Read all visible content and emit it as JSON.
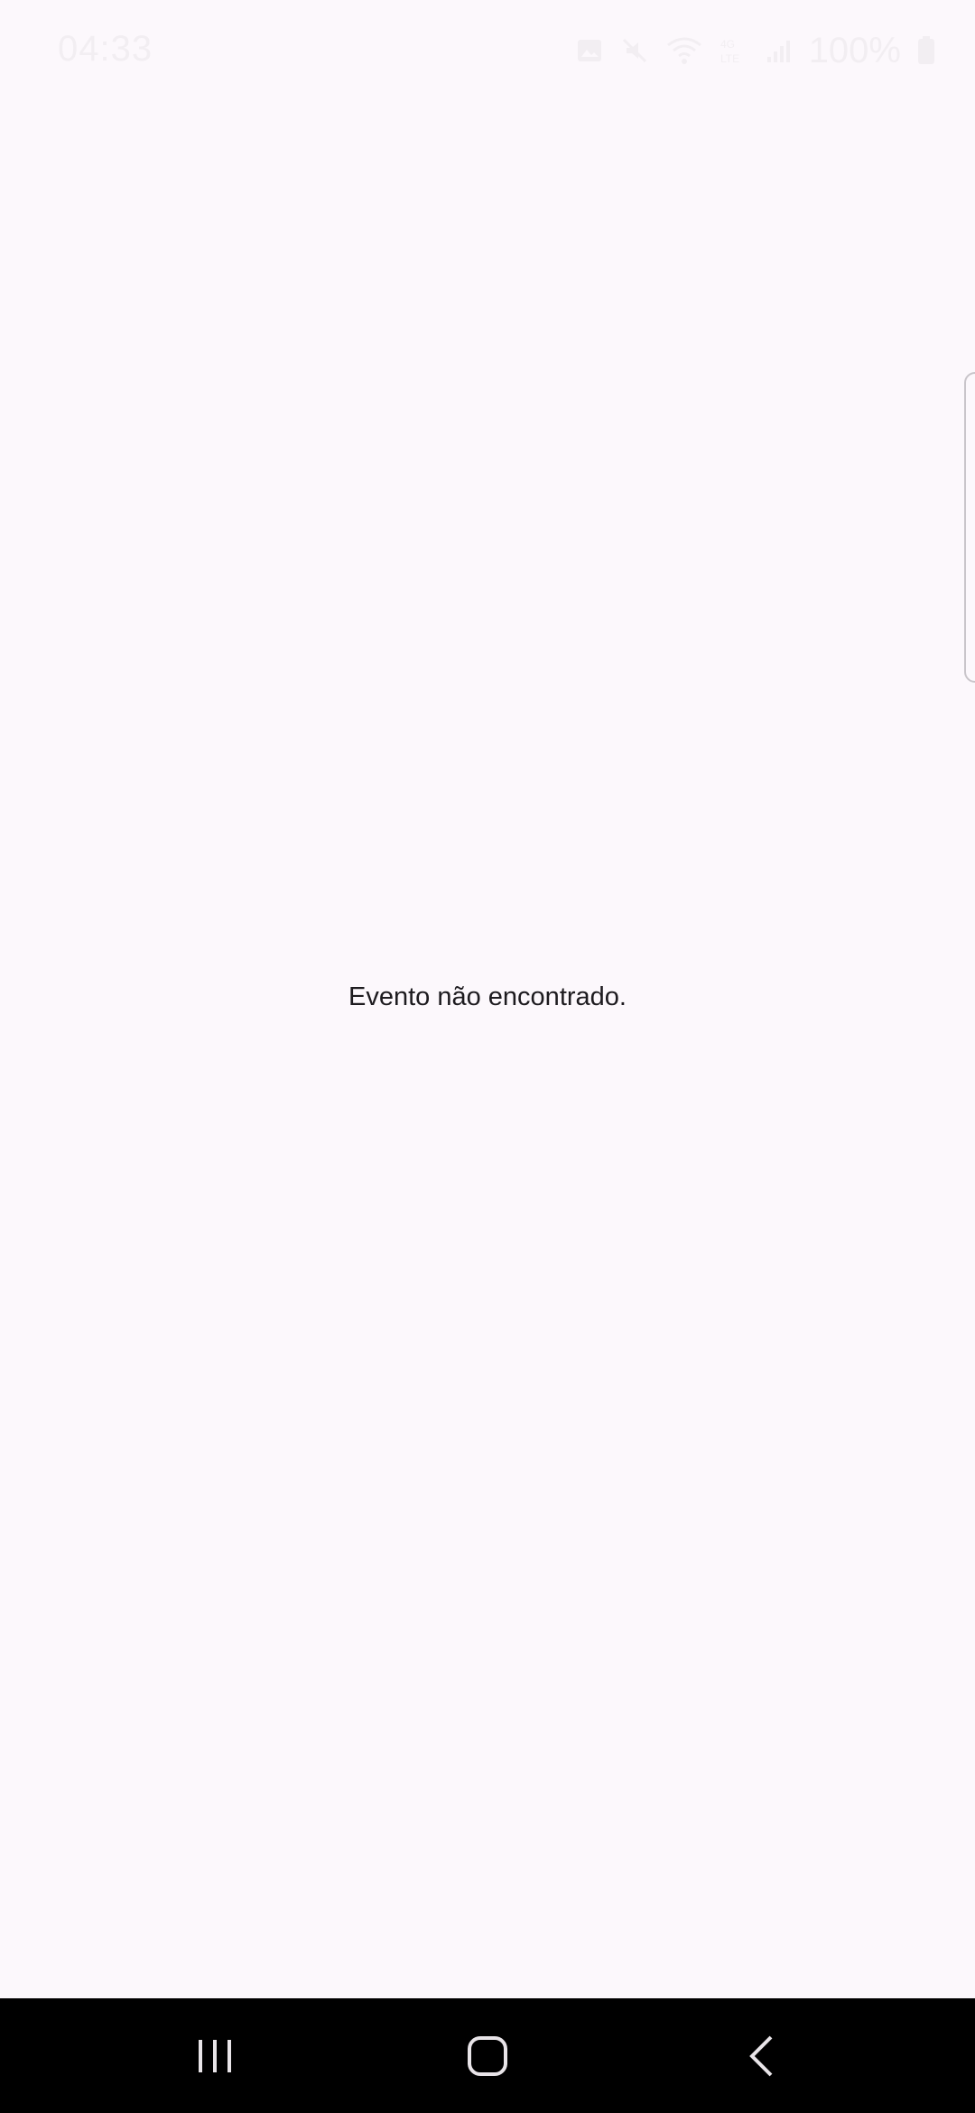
{
  "status_bar": {
    "time": "04:33",
    "battery": "100%",
    "icons": [
      "image-icon",
      "mute-icon",
      "wifi-icon",
      "lte-icon",
      "signal-icon",
      "battery-icon"
    ]
  },
  "main": {
    "message": "Evento não encontrado."
  },
  "nav_bar": {
    "buttons": [
      "recent-apps-button",
      "home-button",
      "back-button"
    ]
  },
  "colors": {
    "background": "#fcf8fc",
    "text": "#1d1b1f",
    "nav_background": "#000000",
    "status_text": "#f2eef2"
  }
}
